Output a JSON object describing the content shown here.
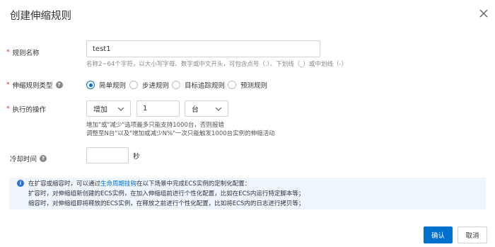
{
  "dialog": {
    "title": "创建伸缩规则"
  },
  "rule_name": {
    "label": "规则名称",
    "value": "test1",
    "hint": "名称2~64个字符，以大小写字母、数字或中文开头，可包含点号（.）、下划线（_）或中划线（-）"
  },
  "rule_type": {
    "label": "伸缩规则类型",
    "options": [
      {
        "label": "简单规则",
        "selected": true
      },
      {
        "label": "步进规则",
        "selected": false
      },
      {
        "label": "目标追踪规则",
        "selected": false
      },
      {
        "label": "预测规则",
        "selected": false
      }
    ]
  },
  "operation": {
    "label": "执行的操作",
    "action": "增加",
    "amount": "1",
    "unit": "台",
    "hint1": "增加\"或\"减少\"选项最多只能支持1000台，否则报错",
    "hint2": "调整至N台\"以及\"增加或减少N%\"一次只能触发1000台实例的伸缩活动"
  },
  "cooldown": {
    "label": "冷却时间",
    "value": "",
    "unit": "秒"
  },
  "info": {
    "line1_prefix": "在扩容或缩容时，可以通过",
    "line1_link": "生命周期挂钩",
    "line1_suffix": "在以下场景中完成ECS实例的定制化配置：",
    "line2": "扩容时，对伸缩组新创建的ECS实例，在加入伸缩组前进行个性化配置，比如在ECS内运行特定脚本等；",
    "line3": "缩容时，对伸缩组即将释放的ECS实例，在释放之前进行个性化配置，比如将ECS内的日志进行拷贝等；"
  },
  "footer": {
    "confirm_label": "确认",
    "cancel_label": "取消"
  },
  "colors": {
    "primary": "#0070cc",
    "required": "#e2231a",
    "info_bg": "#eef5fd"
  }
}
